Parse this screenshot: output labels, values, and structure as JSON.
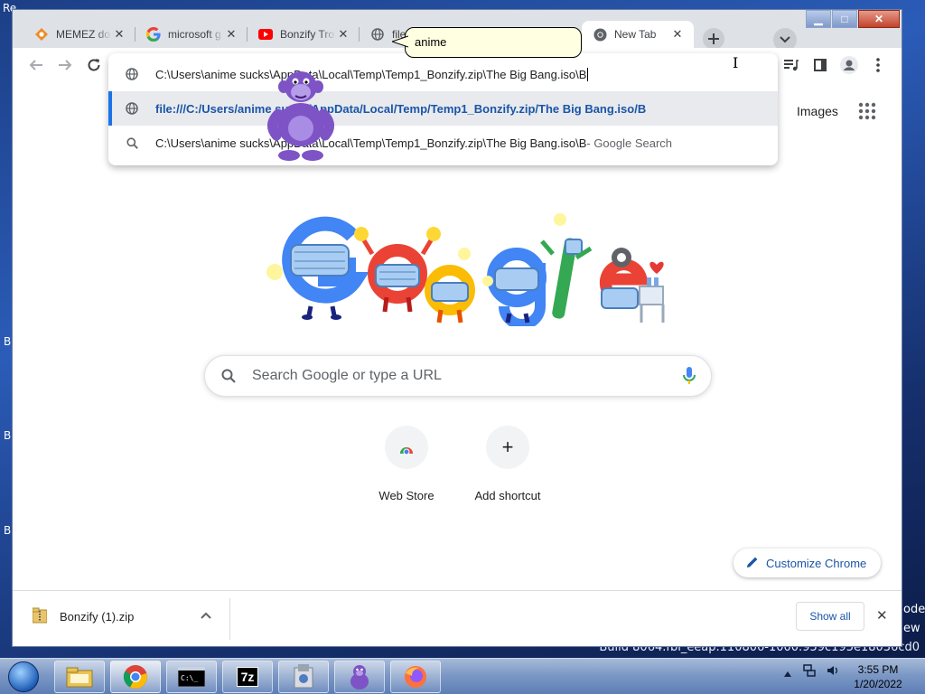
{
  "desktop": {
    "edge_labels": [
      "Re",
      "B",
      "B",
      "B"
    ],
    "build_text": "Build 8064.fbl_eeap.110806-1000.959c195e18036cd0",
    "right_fragments": [
      "ode",
      "ew"
    ]
  },
  "window": {
    "controls": {
      "minimize": "▁",
      "maximize": "□",
      "close": "✕"
    }
  },
  "tabs": [
    {
      "title": "MEMEZ do",
      "icon": "memez-icon",
      "close": "✕"
    },
    {
      "title": "microsoft g",
      "icon": "google-g-icon",
      "close": "✕"
    },
    {
      "title": "Bonzify Tro",
      "icon": "youtube-icon",
      "close": "✕"
    },
    {
      "title": "file",
      "icon": "globe-icon",
      "close": ""
    },
    {
      "title": "New Tab",
      "icon": "chrome-icon",
      "close": "✕",
      "active": true
    }
  ],
  "toolbar": {
    "omnibox_text": "C:\\Users\\anime sucks\\AppData\\Local\\Temp\\Temp1_Bonzify.zip\\The Big Bang.iso\\B"
  },
  "omnibox": {
    "suggestions": [
      {
        "icon": "globe-icon",
        "text": "file:///C:/Users/anime sucks/AppData/Local/Temp/Temp1_Bonzify.zip/The Big Bang.iso/B",
        "suffix": ""
      },
      {
        "icon": "search-icon",
        "text": "C:\\Users\\anime sucks\\AppData\\Local\\Temp\\Temp1_Bonzify.zip\\The Big Bang.iso\\B",
        "suffix": " - Google Search"
      }
    ]
  },
  "ntp": {
    "gmail_fragment": "il",
    "images": "Images",
    "search_placeholder": "Search Google or type a URL",
    "shortcuts": [
      {
        "label": "Web Store"
      },
      {
        "label": "Add shortcut",
        "glyph": "+"
      }
    ],
    "customize": "Customize Chrome"
  },
  "downloads": {
    "file": "Bonzify (1).zip",
    "show_all": "Show all",
    "close": "✕"
  },
  "balloon": {
    "text": "anime"
  },
  "taskbar": {
    "time": "3:55 PM",
    "date": "1/20/2022",
    "seven_zip": "7z"
  },
  "colors": {
    "accent": "#1a73e8",
    "link": "#1a55a8",
    "chrome_frame": "#dee1e6",
    "bonzi_purple": "#7e53c6"
  }
}
